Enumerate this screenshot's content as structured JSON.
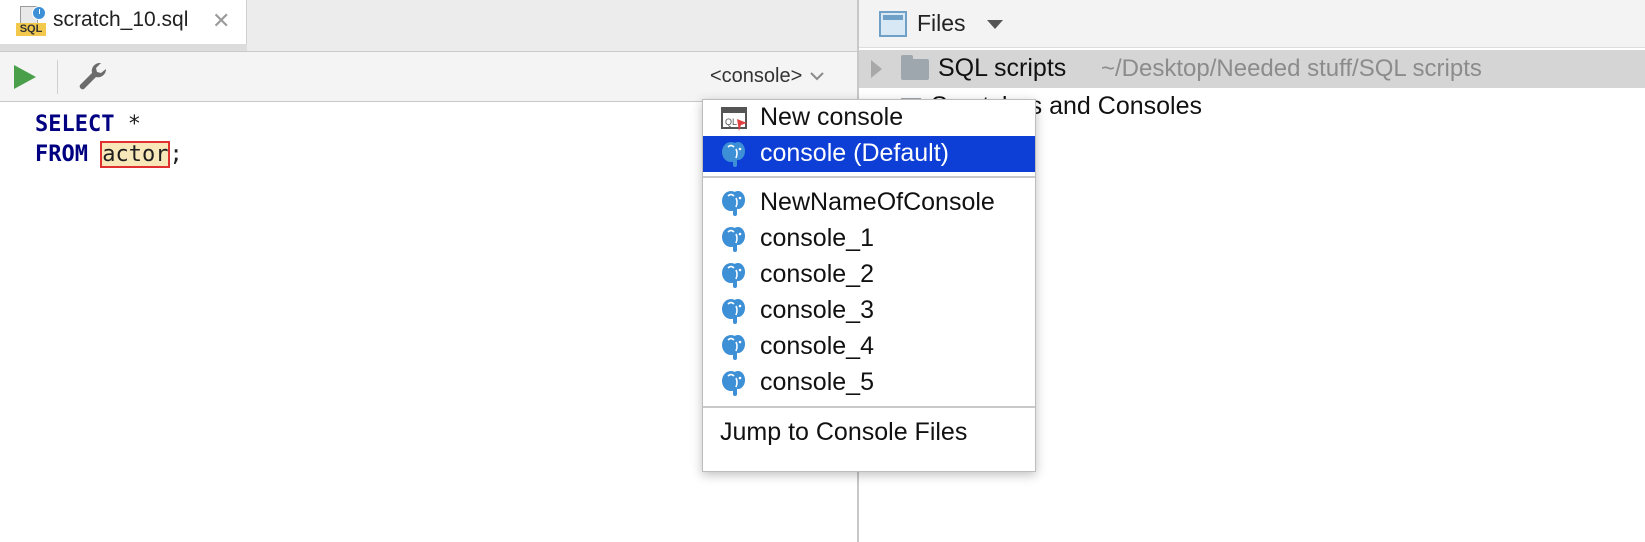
{
  "editor": {
    "tab": {
      "title": "scratch_10.sql",
      "icon_badge_text": "SQL",
      "icon": "sql-scratch-file-icon",
      "close_glyph": "✕"
    },
    "toolbar": {
      "run_icon": "run-icon",
      "settings_icon": "wrench-icon",
      "console_selector": "<console>"
    },
    "code": {
      "line1_keyword": "SELECT",
      "line1_rest": " *",
      "line2_keyword": "FROM",
      "line2_space": " ",
      "line2_table": "actor",
      "line2_end": ";"
    }
  },
  "files_panel": {
    "title": "Files",
    "icon": "files-panel-icon",
    "tree": [
      {
        "label": "SQL scripts",
        "path": "~/Desktop/Needed stuff/SQL scripts",
        "icon": "folder-icon",
        "selected": true
      },
      {
        "label": "Scratches and Consoles",
        "icon": "scratches-icon"
      }
    ]
  },
  "console_menu": {
    "new_console": "New console",
    "default_console": "console (Default)",
    "consoles": [
      "NewNameOfConsole",
      "console_1",
      "console_2",
      "console_3",
      "console_4",
      "console_5"
    ],
    "jump": "Jump to Console Files",
    "item_icon": "postgresql-elephant-icon"
  },
  "colors": {
    "selection": "#0d3fd6",
    "keyword": "#000080",
    "run_green": "#4aa04a",
    "postgres_blue": "#3d8fd6"
  }
}
